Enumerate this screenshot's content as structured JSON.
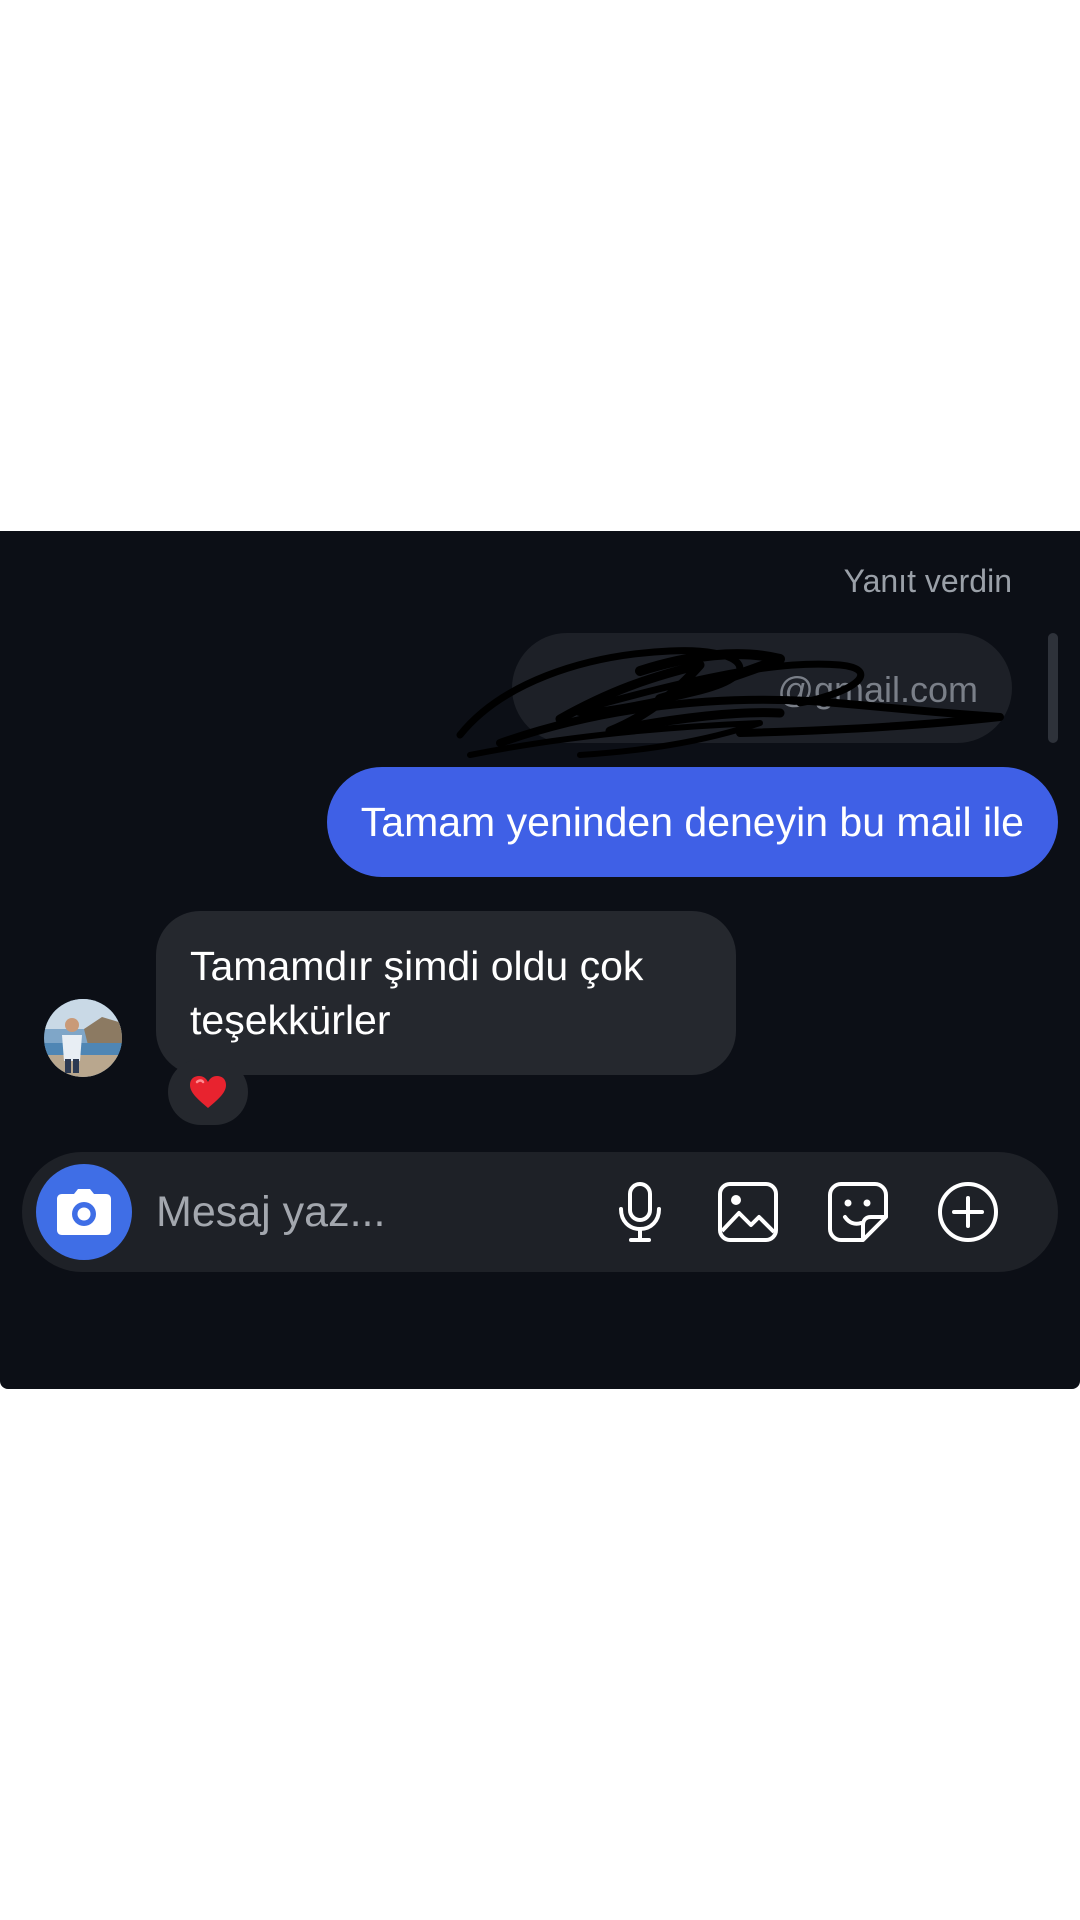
{
  "thread": {
    "reply_label": "Yanıt verdin",
    "quoted_message": "@gmail.com",
    "messages": [
      {
        "direction": "sent",
        "text": "Tamam yeninden deneyin bu mail ile"
      },
      {
        "direction": "received",
        "text": "Tamamdır şimdi oldu çok teşekkürler",
        "reaction": "❤️"
      }
    ]
  },
  "composer": {
    "placeholder": "Mesaj yaz...",
    "icons": [
      "camera-icon",
      "microphone-icon",
      "gallery-icon",
      "sticker-icon",
      "plus-circle-icon"
    ]
  },
  "colors": {
    "panel_bg": "#0c0f16",
    "sent_bubble": "#3f60e6",
    "received_bubble": "#25282e",
    "camera_button": "#3f6ee6"
  }
}
